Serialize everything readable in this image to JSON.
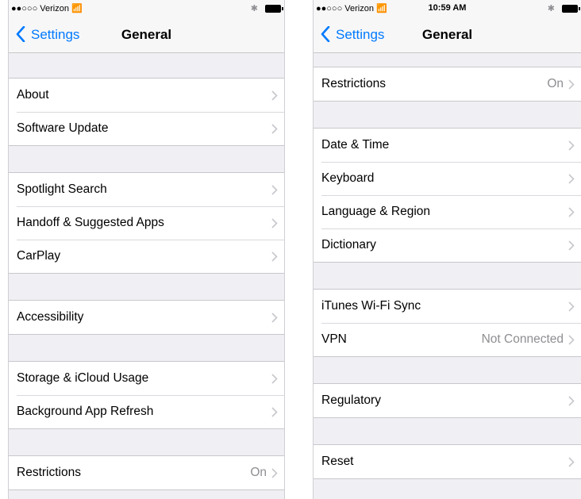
{
  "colors": {
    "accent": "#007aff",
    "background": "#efeff4",
    "secondary_text": "#8e8e93"
  },
  "left_screen": {
    "status": {
      "carrier": "●●○○○ Verizon",
      "wifi_icon": "wifi-icon",
      "time": ""
    },
    "nav": {
      "back_label": "Settings",
      "title": "General"
    },
    "groups": [
      [
        {
          "label": "About"
        },
        {
          "label": "Software Update"
        }
      ],
      [
        {
          "label": "Spotlight Search"
        },
        {
          "label": "Handoff & Suggested Apps"
        },
        {
          "label": "CarPlay"
        }
      ],
      [
        {
          "label": "Accessibility"
        }
      ],
      [
        {
          "label": "Storage & iCloud Usage"
        },
        {
          "label": "Background App Refresh"
        }
      ],
      [
        {
          "label": "Restrictions",
          "value": "On"
        }
      ]
    ]
  },
  "right_screen": {
    "status": {
      "carrier": "●●○○○ Verizon",
      "wifi_icon": "wifi-icon",
      "time": "10:59 AM"
    },
    "nav": {
      "back_label": "Settings",
      "title": "General"
    },
    "groups": [
      [
        {
          "label": "Restrictions",
          "value": "On"
        }
      ],
      [
        {
          "label": "Date & Time"
        },
        {
          "label": "Keyboard"
        },
        {
          "label": "Language & Region"
        },
        {
          "label": "Dictionary"
        }
      ],
      [
        {
          "label": "iTunes Wi-Fi Sync"
        },
        {
          "label": "VPN",
          "value": "Not Connected"
        }
      ],
      [
        {
          "label": "Regulatory"
        }
      ],
      [
        {
          "label": "Reset"
        }
      ]
    ]
  }
}
